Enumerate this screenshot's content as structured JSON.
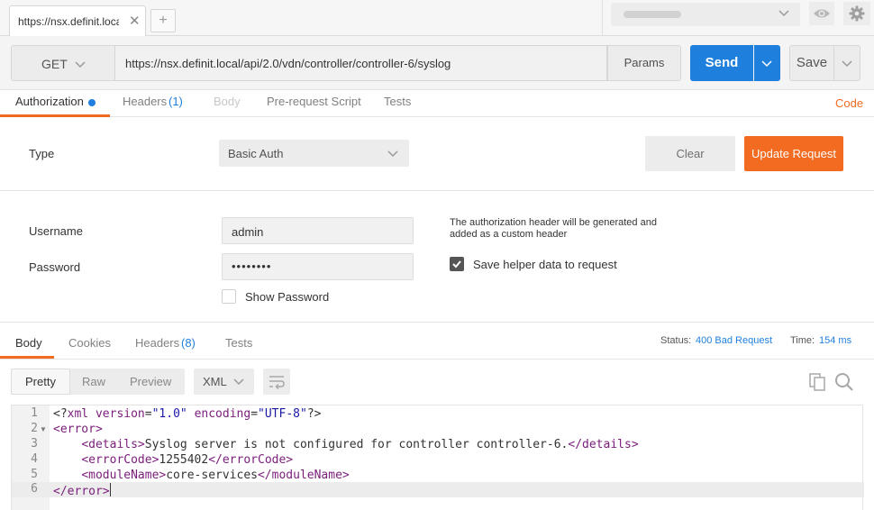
{
  "tabs": [
    {
      "label": "https://nsx.definit.local"
    }
  ],
  "tab_add_label": "+",
  "tab_close_label": "✕",
  "request": {
    "method": "GET",
    "url": "https://nsx.definit.local/api/2.0/vdn/controller/controller-6/syslog",
    "params_label": "Params",
    "send_label": "Send",
    "save_label": "Save"
  },
  "request_tabs": {
    "authorization": "Authorization",
    "headers": "Headers",
    "headers_count": "(1)",
    "body": "Body",
    "prerequest": "Pre-request Script",
    "tests": "Tests",
    "code": "Code"
  },
  "auth": {
    "type_label": "Type",
    "type_value": "Basic Auth",
    "clear_label": "Clear",
    "update_label": "Update Request",
    "username_label": "Username",
    "username_value": "admin",
    "password_label": "Password",
    "password_value": "••••••••",
    "show_password_label": "Show Password",
    "note": "The authorization header will be generated and added as a custom header",
    "save_helper_label": "Save helper data to request",
    "save_helper_checked": true
  },
  "response_tabs": {
    "body": "Body",
    "cookies": "Cookies",
    "headers": "Headers",
    "headers_count": "(8)",
    "tests": "Tests"
  },
  "response": {
    "status_label": "Status:",
    "status_value": "400 Bad Request",
    "time_label": "Time:",
    "time_value": "154 ms",
    "format_options": [
      "Pretty",
      "Raw",
      "Preview"
    ],
    "format_selected": "Pretty",
    "language": "XML"
  },
  "code_lines": [
    "<?xml version=\"1.0\" encoding=\"UTF-8\"?>",
    "<error>",
    "    <details>Syslog server is not configured for controller controller-6.</details>",
    "    <errorCode>1255402</errorCode>",
    "    <moduleName>core-services</moduleName>",
    "</error>"
  ],
  "line_numbers": [
    "1",
    "2",
    "3",
    "4",
    "5",
    "6"
  ],
  "colors": {
    "accent_orange": "#f26b21",
    "primary_blue": "#1f7fdd",
    "xml_tag": "#7a1d7a",
    "xml_string": "#1a1aa6"
  }
}
